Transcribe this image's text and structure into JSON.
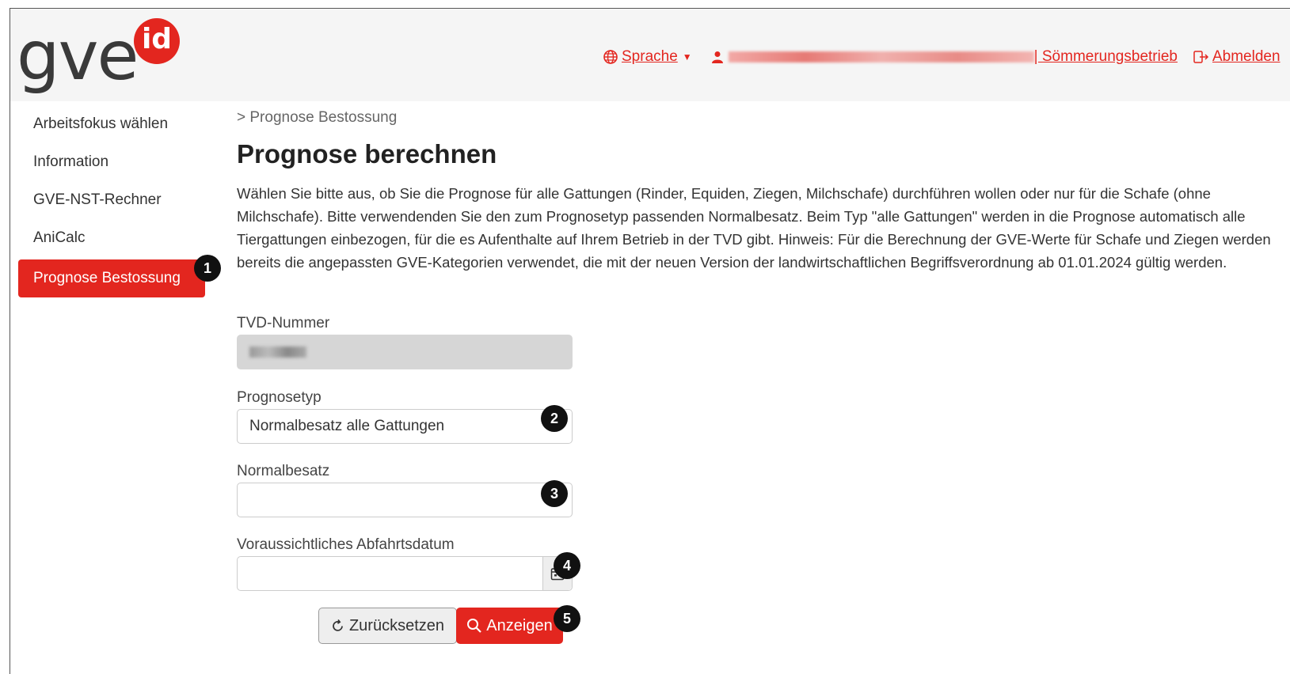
{
  "logo": {
    "text": "gve",
    "badge": "id"
  },
  "topnav": {
    "language_label": "Sprache",
    "user_suffix": " | Sömmerungsbetrieb",
    "logout_label": "Abmelden"
  },
  "sidebar": {
    "items": [
      {
        "label": "Arbeitsfokus wählen"
      },
      {
        "label": "Information"
      },
      {
        "label": "GVE-NST-Rechner"
      },
      {
        "label": "AniCalc"
      },
      {
        "label": "Prognose Bestossung"
      }
    ]
  },
  "main": {
    "breadcrumb": "> Prognose Bestossung",
    "title": "Prognose berechnen",
    "description": "Wählen Sie bitte aus, ob Sie die Prognose für alle Gattungen (Rinder, Equiden, Ziegen, Milchschafe) durchführen wollen oder nur für die Schafe (ohne Milchschafe). Bitte verwendenden Sie den zum Prognosetyp passenden Normalbesatz. Beim Typ \"alle Gattungen\" werden in die Prognose automatisch alle Tiergattungen einbezogen, für die es Aufenthalte auf Ihrem Betrieb in der TVD gibt. Hinweis: Für die Berechnung der GVE-Werte für Schafe und Ziegen werden bereits die angepassten GVE-Kategorien verwendet, die mit der neuen Version der landwirtschaftlichen Begriffsverordnung ab 01.01.2024 gültig werden."
  },
  "form": {
    "tvd_label": "TVD-Nummer",
    "prognosetyp_label": "Prognosetyp",
    "prognosetyp_value": "Normalbesatz alle Gattungen",
    "normalbesatz_label": "Normalbesatz",
    "normalbesatz_value": "",
    "date_label": "Voraussichtliches Abfahrtsdatum",
    "date_value": "",
    "reset_label": "Zurücksetzen",
    "show_label": "Anzeigen"
  },
  "markers": [
    "1",
    "2",
    "3",
    "4",
    "5"
  ],
  "colors": {
    "accent": "#e3261f",
    "marker": "#111111",
    "header_bg": "#f5f5f5"
  },
  "icons": [
    "globe-icon",
    "user-icon",
    "logout-icon",
    "calendar-icon",
    "refresh-icon",
    "search-icon",
    "chevron-down-icon"
  ]
}
